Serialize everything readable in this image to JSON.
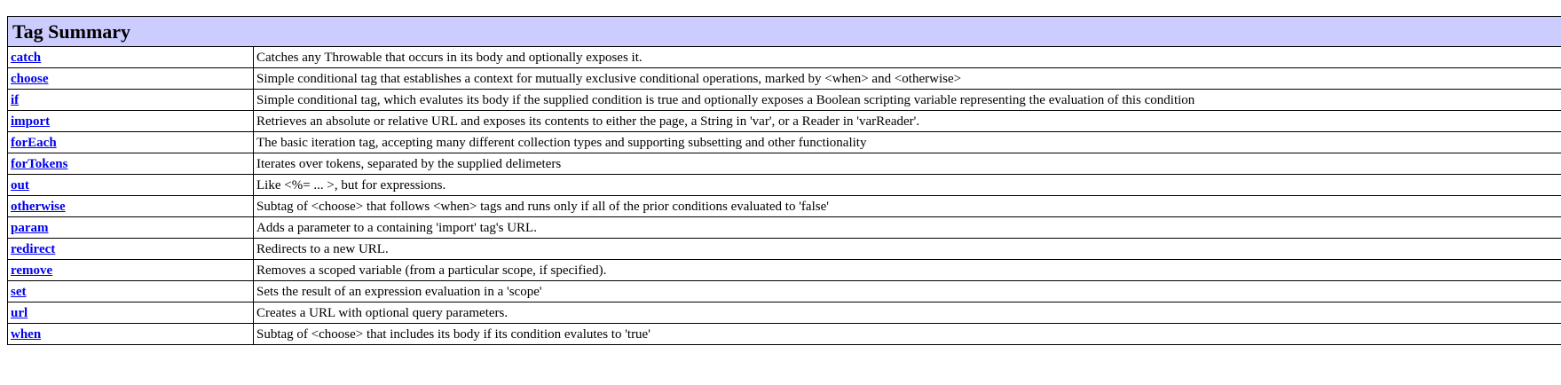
{
  "summary": {
    "title": "Tag Summary",
    "rows": [
      {
        "name": "catch",
        "description": "Catches any Throwable that occurs in its body and optionally exposes it."
      },
      {
        "name": "choose",
        "description": "Simple conditional tag that establishes a context for mutually exclusive conditional operations, marked by <when> and <otherwise>"
      },
      {
        "name": "if",
        "description": "Simple conditional tag, which evalutes its body if the supplied condition is true and optionally exposes a Boolean scripting variable representing the evaluation of this condition"
      },
      {
        "name": "import",
        "description": "Retrieves an absolute or relative URL and exposes its contents to either the page, a String in 'var', or a Reader in 'varReader'."
      },
      {
        "name": "forEach",
        "description": "The basic iteration tag, accepting many different collection types and supporting subsetting and other functionality"
      },
      {
        "name": "forTokens",
        "description": "Iterates over tokens, separated by the supplied delimeters"
      },
      {
        "name": "out",
        "description": "Like <%= ... >, but for expressions."
      },
      {
        "name": "otherwise",
        "description": "Subtag of <choose> that follows <when> tags and runs only if all of the prior conditions evaluated to 'false'"
      },
      {
        "name": "param",
        "description": "Adds a parameter to a containing 'import' tag's URL."
      },
      {
        "name": "redirect",
        "description": "Redirects to a new URL."
      },
      {
        "name": "remove",
        "description": "Removes a scoped variable (from a particular scope, if specified)."
      },
      {
        "name": "set",
        "description": "Sets the result of an expression evaluation in a 'scope'"
      },
      {
        "name": "url",
        "description": "Creates a URL with optional query parameters."
      },
      {
        "name": "when",
        "description": "Subtag of <choose> that includes its body if its condition evalutes to 'true'"
      }
    ]
  }
}
